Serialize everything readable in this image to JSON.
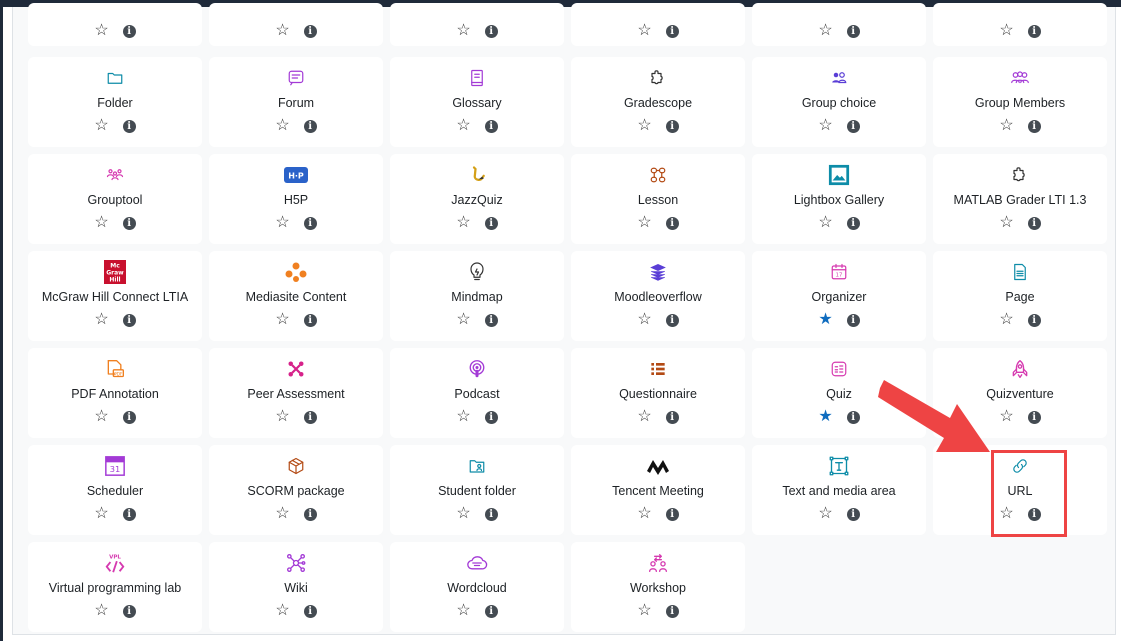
{
  "rows": [
    [
      {
        "name": "",
        "icon": "",
        "favorite": false
      },
      {
        "name": "",
        "icon": "",
        "favorite": false
      },
      {
        "name": "",
        "icon": "",
        "favorite": false
      },
      {
        "name": "",
        "icon": "",
        "favorite": false
      },
      {
        "name": "",
        "icon": "",
        "favorite": false
      },
      {
        "name": "",
        "icon": "",
        "favorite": false
      }
    ]
  ],
  "activities": [
    {
      "name": "Folder",
      "icon": "folder-icon",
      "color": "#0d8ca8",
      "favorite": false
    },
    {
      "name": "Forum",
      "icon": "forum-icon",
      "color": "#a33ad6",
      "favorite": false
    },
    {
      "name": "Glossary",
      "icon": "glossary-icon",
      "color": "#a33ad6",
      "favorite": false
    },
    {
      "name": "Gradescope",
      "icon": "puzzle-icon",
      "color": "#333333",
      "favorite": false
    },
    {
      "name": "Group choice",
      "icon": "group-choice-icon",
      "color": "#5a3ed6",
      "favorite": false
    },
    {
      "name": "Group Members",
      "icon": "group-members-icon",
      "color": "#a33ad6",
      "favorite": false
    },
    {
      "name": "Grouptool",
      "icon": "grouptool-icon",
      "color": "#d63ab0",
      "favorite": false
    },
    {
      "name": "H5P",
      "icon": "h5p-icon",
      "color": "#2a62c9",
      "favorite": false
    },
    {
      "name": "JazzQuiz",
      "icon": "saxophone-icon",
      "color": "#d4a017",
      "favorite": false
    },
    {
      "name": "Lesson",
      "icon": "lesson-icon",
      "color": "#b34a14",
      "favorite": false
    },
    {
      "name": "Lightbox Gallery",
      "icon": "gallery-icon",
      "color": "#0d8ca8",
      "favorite": false
    },
    {
      "name": "MATLAB Grader LTI 1.3",
      "icon": "puzzle-icon",
      "color": "#333333",
      "favorite": false
    },
    {
      "name": "McGraw Hill Connect LTIA",
      "icon": "mcgraw-hill-logo-icon",
      "color": "#c8102e",
      "favorite": false
    },
    {
      "name": "Mediasite Content",
      "icon": "mediasite-icon",
      "color": "#f08020",
      "favorite": false
    },
    {
      "name": "Mindmap",
      "icon": "lightbulb-icon",
      "color": "#333333",
      "favorite": false
    },
    {
      "name": "Moodleoverflow",
      "icon": "stack-icon",
      "color": "#5a3ed6",
      "favorite": false
    },
    {
      "name": "Organizer",
      "icon": "calendar-icon",
      "color": "#d63ab0",
      "favorite": true
    },
    {
      "name": "Page",
      "icon": "page-icon",
      "color": "#0d8ca8",
      "favorite": false
    },
    {
      "name": "PDF Annotation",
      "icon": "pdf-annotation-icon",
      "color": "#f08020",
      "favorite": false
    },
    {
      "name": "Peer Assessment",
      "icon": "peer-assessment-icon",
      "color": "#d6228a",
      "favorite": false
    },
    {
      "name": "Podcast",
      "icon": "podcast-icon",
      "color": "#a33ad6",
      "favorite": false
    },
    {
      "name": "Questionnaire",
      "icon": "questionnaire-icon",
      "color": "#b34a14",
      "favorite": false
    },
    {
      "name": "Quiz",
      "icon": "quiz-icon",
      "color": "#d63ab0",
      "favorite": true
    },
    {
      "name": "Quizventure",
      "icon": "rocket-icon",
      "color": "#d63ab0",
      "favorite": false
    },
    {
      "name": "Scheduler",
      "icon": "scheduler-icon",
      "color": "#a33ad6",
      "favorite": false
    },
    {
      "name": "SCORM package",
      "icon": "scorm-box-icon",
      "color": "#b34a14",
      "favorite": false
    },
    {
      "name": "Student folder",
      "icon": "student-folder-icon",
      "color": "#0d8ca8",
      "favorite": false
    },
    {
      "name": "Tencent Meeting",
      "icon": "tencent-meeting-icon",
      "color": "#111111",
      "favorite": false
    },
    {
      "name": "Text and media area",
      "icon": "text-media-icon",
      "color": "#0d8ca8",
      "favorite": false
    },
    {
      "name": "URL",
      "icon": "link-icon",
      "color": "#0d8ca8",
      "favorite": false
    },
    {
      "name": "Virtual programming lab",
      "icon": "vpl-icon",
      "color": "#d63ab0",
      "favorite": false
    },
    {
      "name": "Wiki",
      "icon": "wiki-icon",
      "color": "#a33ad6",
      "favorite": false
    },
    {
      "name": "Wordcloud",
      "icon": "wordcloud-icon",
      "color": "#a33ad6",
      "favorite": false
    },
    {
      "name": "Workshop",
      "icon": "workshop-icon",
      "color": "#d63ab0",
      "favorite": false
    }
  ],
  "info_glyph": "i",
  "star_empty": "☆",
  "star_full": "★",
  "annotation_color": "#ee4444"
}
